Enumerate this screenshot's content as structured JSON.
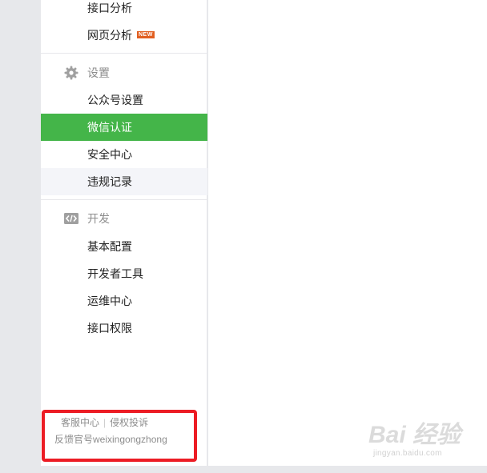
{
  "sidebar": {
    "analytics_items": [
      {
        "label": "接口分析"
      },
      {
        "label": "网页分析",
        "badge": "NEW"
      }
    ],
    "settings": {
      "title": "设置",
      "icon": "gear-icon",
      "items": [
        {
          "label": "公众号设置"
        },
        {
          "label": "微信认证",
          "active": true
        },
        {
          "label": "安全中心"
        },
        {
          "label": "违规记录"
        }
      ]
    },
    "develop": {
      "title": "开发",
      "icon": "code-icon",
      "items": [
        {
          "label": "基本配置"
        },
        {
          "label": "开发者工具"
        },
        {
          "label": "运维中心"
        },
        {
          "label": "接口权限"
        }
      ]
    },
    "footer": {
      "customer_service": "客服中心",
      "separator": "|",
      "complaint": "侵权投诉",
      "feedback": "反馈官号weixingongzhong"
    }
  },
  "watermark": {
    "logo": "Bai 经验",
    "url": "jingyan.baidu.com"
  },
  "colors": {
    "accent": "#44b549",
    "badge": "#e15f21",
    "highlight_box": "#ec1c24"
  }
}
